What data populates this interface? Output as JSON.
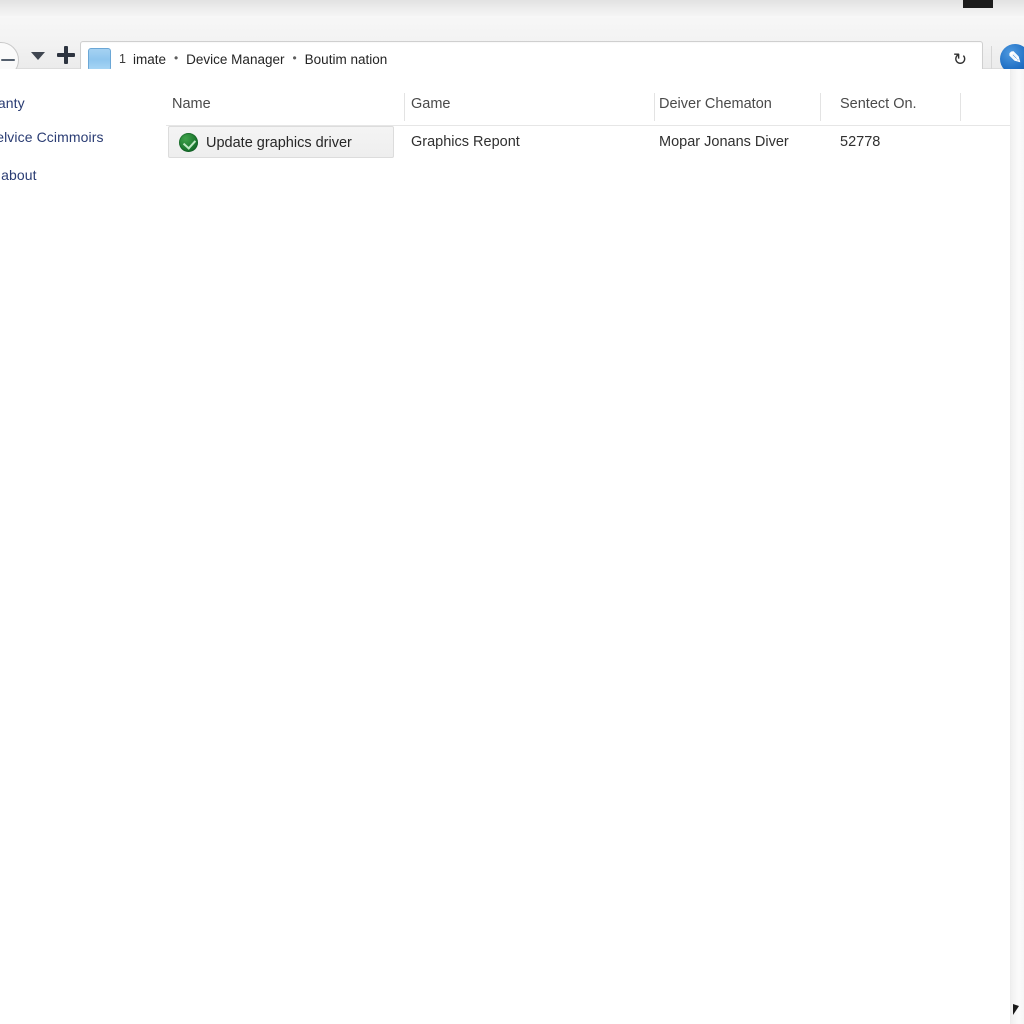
{
  "window": {
    "controls": [
      {
        "name": "maximize",
        "glyph": ""
      }
    ]
  },
  "toolbar": {
    "back_label": "",
    "dropdown_label": "",
    "new_tab_label": "",
    "refresh_glyph": "↻",
    "action_glyph": "✎",
    "address": {
      "icon": "folder-icon",
      "index": "1",
      "crumbs": [
        "imate",
        "Device Manager",
        "Boutim nation"
      ],
      "separator": "•"
    }
  },
  "sidebar": {
    "items": [
      {
        "label": "ntanty"
      },
      {
        "label": "Delvice Ccimmoirs"
      },
      {
        "label": "le about"
      }
    ]
  },
  "table": {
    "columns": [
      {
        "label": "Name"
      },
      {
        "label": "Game"
      },
      {
        "label": "Deiver Chematon"
      },
      {
        "label": "Sentect On."
      }
    ],
    "rows": [
      {
        "name": "Update graphics driver",
        "name_icon": "green-update-icon",
        "game": "Graphics Repont",
        "driver": "Mopar Jonans Diver",
        "date": "52778"
      }
    ]
  },
  "colors": {
    "accent_blue": "#1f6fc4",
    "status_green": "#1d7a30",
    "sidebar_link": "#2a3c73",
    "header_text": "#4a4a4a",
    "chip_bg": "#f1f1f1",
    "toolbar_bg": "#f2f2f2"
  }
}
